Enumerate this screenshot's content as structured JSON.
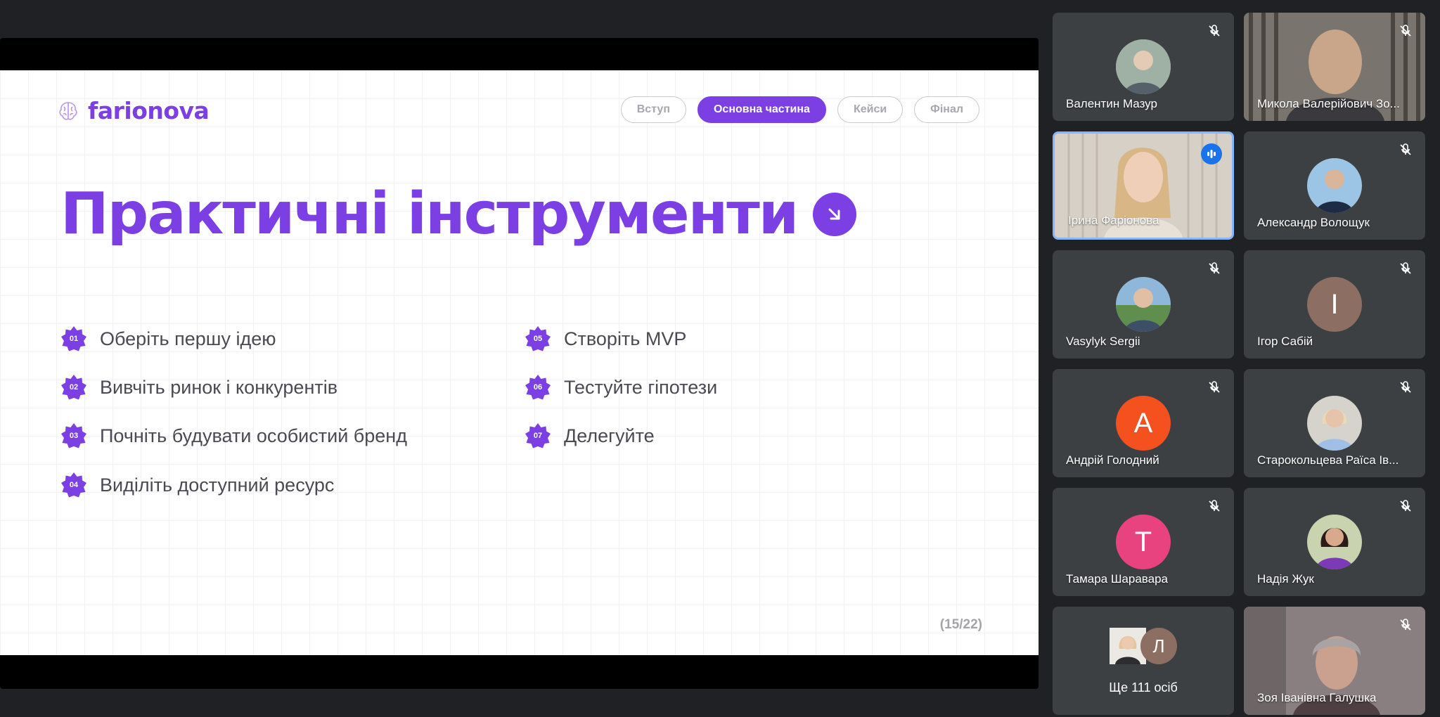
{
  "slide": {
    "brand": "farionova",
    "nav": [
      "Вступ",
      "Основна частина",
      "Кейси",
      "Фінал"
    ],
    "nav_active_index": 1,
    "title": "Практичні інструменти",
    "items": [
      {
        "num": "01",
        "text": "Оберіть першу ідею"
      },
      {
        "num": "02",
        "text": "Вивчіть ринок і конкурентів"
      },
      {
        "num": "03",
        "text": "Почніть будувати особистий бренд"
      },
      {
        "num": "04",
        "text": "Виділіть доступний ресурс"
      },
      {
        "num": "05",
        "text": "Створіть MVP"
      },
      {
        "num": "06",
        "text": "Тестуйте гіпотези"
      },
      {
        "num": "07",
        "text": "Делегуйте"
      }
    ],
    "page": "(15/22)",
    "accent_color": "#7b3fe4"
  },
  "participants": [
    {
      "name": "Валентин Мазур",
      "muted": true,
      "avatar_icon": "photo-avatar"
    },
    {
      "name": "Микола Валерійович Зо...",
      "muted": true,
      "avatar_icon": "camera-video"
    },
    {
      "name": "Ірина Фаріонова",
      "muted": false,
      "speaking": true,
      "avatar_icon": "camera-video"
    },
    {
      "name": "Александр Волощук",
      "muted": true,
      "avatar_icon": "photo-avatar"
    },
    {
      "name": "Vasylyk Sergii",
      "muted": true,
      "avatar_icon": "photo-avatar"
    },
    {
      "name": "Ігор Сабій",
      "muted": true,
      "initial": "І",
      "color": "#8d6e63"
    },
    {
      "name": "Андрій Голодний",
      "muted": true,
      "initial": "А",
      "color": "#f4511e"
    },
    {
      "name": "Старокольцева Раїса Ів...",
      "muted": true,
      "avatar_icon": "photo-avatar"
    },
    {
      "name": "Тамара Шаравара",
      "muted": true,
      "initial": "Т",
      "color": "#e8437f"
    },
    {
      "name": "Надія Жук",
      "muted": true,
      "avatar_icon": "photo-avatar"
    },
    {
      "name": "Зоя Іванівна Галушка",
      "muted": true,
      "avatar_icon": "camera-video"
    }
  ],
  "more": {
    "label": "Ще 111 осіб",
    "initial": "Л"
  }
}
